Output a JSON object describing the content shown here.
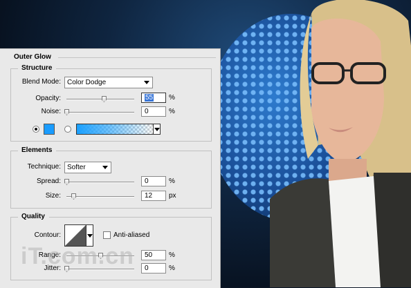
{
  "panel": {
    "title": "Outer Glow"
  },
  "structure": {
    "title": "Structure",
    "blend_mode_label": "Blend Mode:",
    "blend_mode_value": "Color Dodge",
    "opacity_label": "Opacity:",
    "opacity_value": "55",
    "opacity_unit": "%",
    "opacity_level": 0.55,
    "noise_label": "Noise:",
    "noise_value": "0",
    "noise_unit": "%",
    "noise_level": 0,
    "glow_color": "#1a9cff"
  },
  "elements": {
    "title": "Elements",
    "technique_label": "Technique:",
    "technique_value": "Softer",
    "spread_label": "Spread:",
    "spread_value": "0",
    "spread_unit": "%",
    "size_label": "Size:",
    "size_value": "12",
    "size_unit": "px"
  },
  "quality": {
    "title": "Quality",
    "contour_label": "Contour:",
    "anti_aliased_label": "Anti-aliased",
    "anti_aliased_checked": false,
    "range_label": "Range:",
    "range_value": "50",
    "range_unit": "%",
    "jitter_label": "Jitter:",
    "jitter_value": "0",
    "jitter_unit": "%"
  },
  "watermark": {
    "text": "iT.com.cn"
  }
}
